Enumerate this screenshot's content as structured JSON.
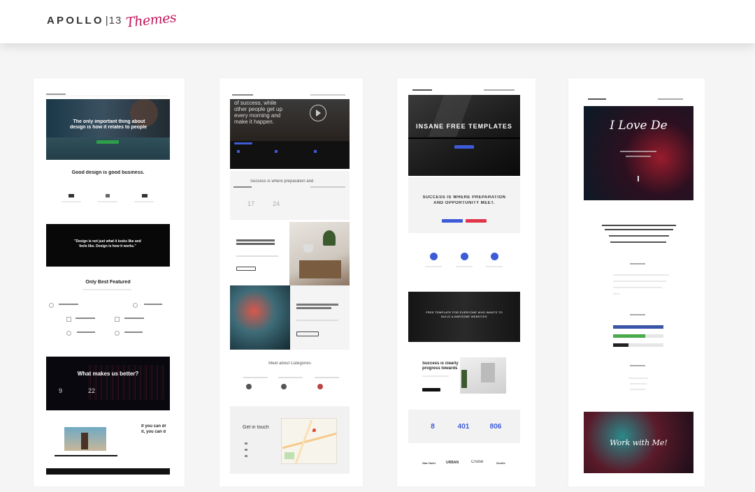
{
  "header": {
    "brand": "APOLLO",
    "brand_number": "13",
    "script_word": "Themes"
  },
  "previews": {
    "p1": {
      "hero_title_line1": "The only important thing about",
      "hero_title_line2": "design is how it relates to people",
      "good_design": "Good design is good business.",
      "quote_line1": "\"Design is not just what it looks like and",
      "quote_line2": "feels like. Design is how it works.\"",
      "featured": "Only Best Featured",
      "better": "What makes us better?",
      "stat_a": "9",
      "stat_b": "22",
      "cta_line1": "If you can dr",
      "cta_line2": "it, you can d"
    },
    "p2": {
      "hero_line1": "of success, while",
      "hero_line2": "other people get up",
      "hero_line3": "every morning and",
      "hero_line4": "make it happen.",
      "success": "Success is where preparation and",
      "categories": "Meet about Categories",
      "get_in_touch": "Get in touch"
    },
    "p3": {
      "hero": "INSANE FREE TEMPLATES",
      "success_line1": "SUCCESS IS WHERE PREPARATION",
      "success_line2": "AND OPPORTUNITY MEET.",
      "band_line1": "FREE TEMPLATE FOR EVERYONE WHO WANTS TO",
      "band_line2": "BUILD A AWESOME WEBSITES",
      "feature_line1": "Success is clearly",
      "feature_line2": "progress towards",
      "stat1": "8",
      "stat2": "401",
      "stat3": "806",
      "logos": [
        "Star Hotel",
        "URBAN",
        "Cruise",
        "Seville"
      ]
    },
    "p4": {
      "hero": "I Love De",
      "work": "Work with Me!"
    }
  },
  "colors": {
    "accent_pink": "#c2185b",
    "green_btn": "#2e9e48",
    "blue_btn": "#3d5bd6",
    "red_btn": "#e0344a"
  }
}
